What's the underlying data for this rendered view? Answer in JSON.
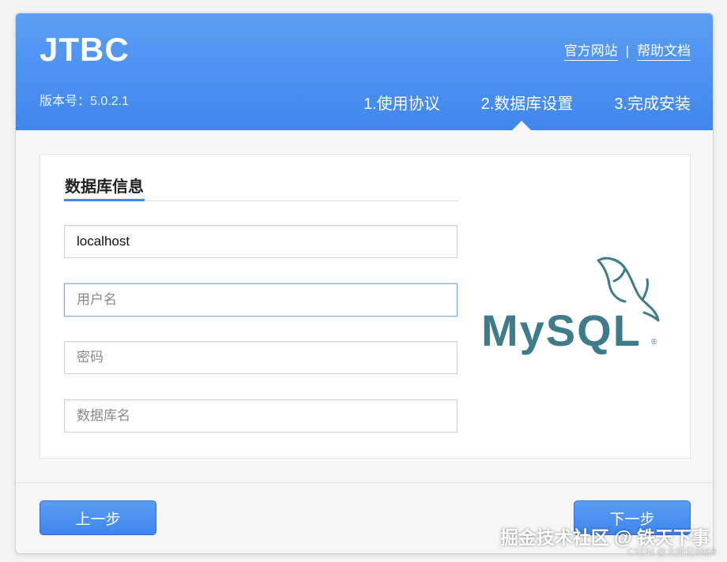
{
  "header": {
    "logo": "JTBC",
    "version": "版本号：5.0.2.1",
    "links": {
      "official_site": "官方网站",
      "separator": "|",
      "docs": "帮助文档"
    },
    "steps": [
      "1.使用协议",
      "2.数据库设置",
      "3.完成安装"
    ],
    "active_step": 2
  },
  "panel": {
    "title": "数据库信息",
    "fields": [
      {
        "value": "localhost",
        "placeholder": ""
      },
      {
        "value": "",
        "placeholder": "用户名"
      },
      {
        "value": "",
        "placeholder": "密码"
      },
      {
        "value": "",
        "placeholder": "数据库名"
      }
    ],
    "mysql_logo": "MySQL"
  },
  "footer": {
    "prev_label": "上一步",
    "next_label": "下一步"
  },
  "watermark": {
    "line1": "掘金技术社区 @ 铁天下事",
    "line2": "CSDN @大帅兄6668"
  },
  "colors": {
    "accent": "#3f86ee",
    "mysql": "#3e7c8c"
  }
}
